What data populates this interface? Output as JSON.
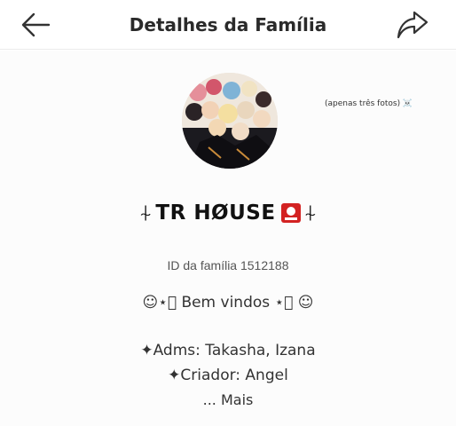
{
  "header": {
    "title": "Detalhes da Família",
    "back_icon": "arrow-left-icon",
    "share_icon": "share-arrow-icon"
  },
  "family": {
    "side_note": "(apenas três fotos) ☠️",
    "name": "TR HØUSE",
    "name_ornament": "⍭",
    "badge_icon": "red-id-badge-icon",
    "id_line": "ID da família 1512188",
    "welcome": "☺⋆͙ Bem vindos ⋆͙ ☺",
    "admins": "✦Adms: Takasha, Izana",
    "creator": "✦Criador: Angel",
    "more": "...  Mais"
  },
  "colors": {
    "badge": "#d32222",
    "text": "#333333",
    "background": "#ffffff"
  }
}
